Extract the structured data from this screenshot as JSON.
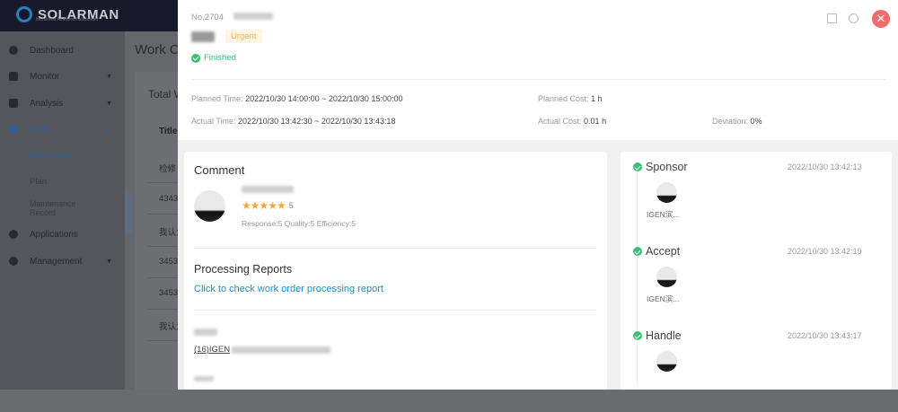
{
  "app": {
    "brand": "SOLARMAN",
    "tagline": "Monitored Analyzed Networked"
  },
  "sidebar": {
    "items": [
      {
        "label": "Dashboard",
        "icon": "dashboard-icon"
      },
      {
        "label": "Monitor",
        "icon": "monitor-icon"
      },
      {
        "label": "Analysis",
        "icon": "analysis-icon"
      },
      {
        "label": "O&M",
        "icon": "gear-icon"
      },
      {
        "label": "Applications",
        "icon": "applications-icon"
      },
      {
        "label": "Management",
        "icon": "management-icon"
      }
    ],
    "subitems": [
      {
        "label": "Work Order"
      },
      {
        "label": "Plan"
      },
      {
        "label": "Maintenance Record"
      }
    ]
  },
  "background_page": {
    "title": "Work O",
    "total_label": "Total W",
    "table_header": "Title",
    "rows": [
      "检修",
      "4343",
      "我认为",
      "3453",
      "3453",
      "我认为"
    ]
  },
  "drawer": {
    "order_no": "No.2704",
    "priority": "Urgent",
    "status": "Finished",
    "planned_time_label": "Planned Time:",
    "planned_time": "2022/10/30 14:00:00 ~ 2022/10/30 15:00:00",
    "actual_time_label": "Actual Time:",
    "actual_time": "2022/10/30 13:42:30 ~ 2022/10/30 13:43:18",
    "planned_cost_label": "Planned Cost:",
    "planned_cost": "1 h",
    "actual_cost_label": "Actual Cost:",
    "actual_cost": "0.01 h",
    "deviation_label": "Deviation:",
    "deviation": "0%",
    "comment": {
      "title": "Comment",
      "rating": 5,
      "rating_text": "5",
      "sub_scores": "Response:5 Quality:5 Efficiency:5"
    },
    "reports": {
      "title": "Processing Reports",
      "link": "Click to check work order processing report",
      "item": "(16)IGEN"
    },
    "colors": {
      "accent": "#1a8fd6",
      "success": "#3cbf74",
      "urgent": "#f5a742",
      "close": "#f26b6b"
    },
    "timeline": [
      {
        "step": "Sponsor",
        "time": "2022/10/30 13:42:13",
        "user": "IGEN滨..."
      },
      {
        "step": "Accept",
        "time": "2022/10/30 13:42:19",
        "user": "IGEN滨..."
      },
      {
        "step": "Handle",
        "time": "2022/10/30 13:43:17",
        "user": ""
      }
    ]
  }
}
